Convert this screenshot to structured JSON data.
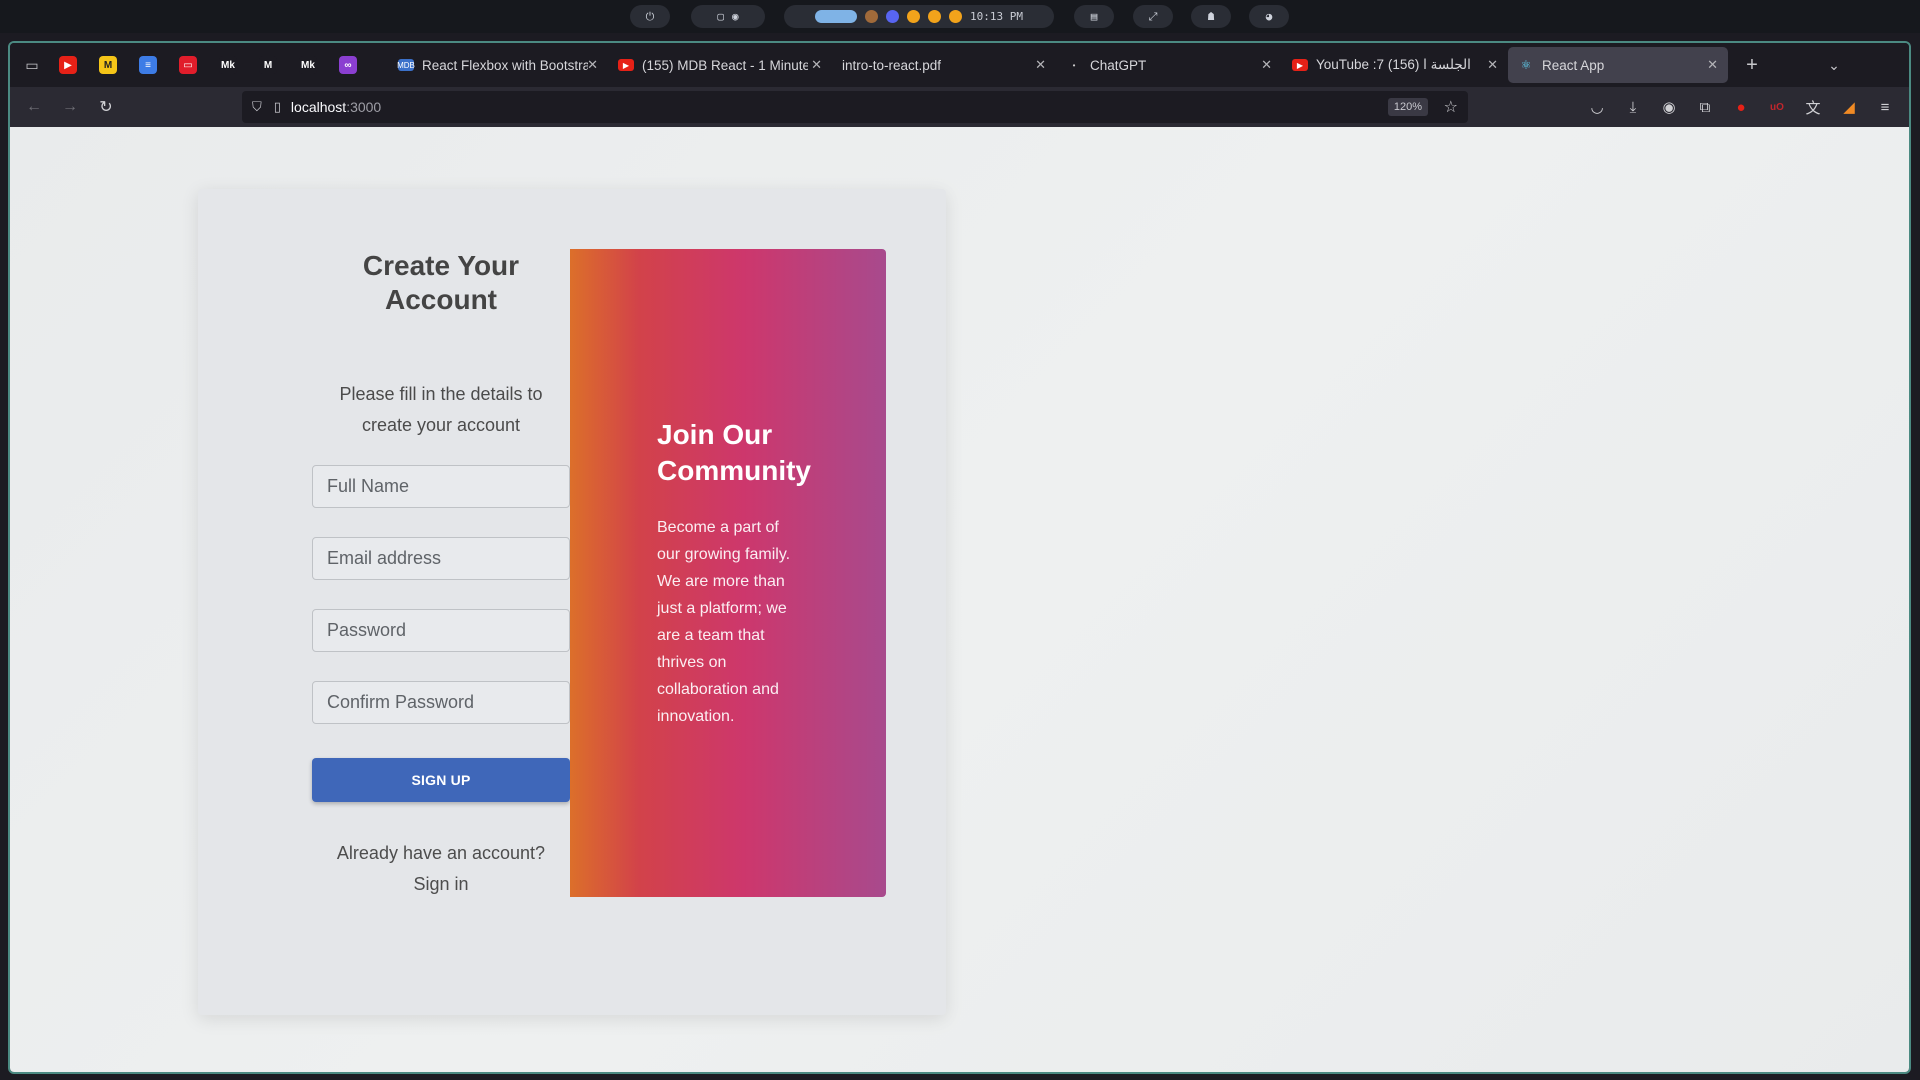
{
  "system_bar": {
    "clock": "10:13 PM"
  },
  "colors": {
    "accent_button": "#3f67b9",
    "window_border": "#4b8a82",
    "gradient_start": "#dc6f2a",
    "gradient_mid": "#cd376c",
    "gradient_end": "#a84a8d"
  },
  "tabs": [
    {
      "title": "React Flexbox with Bootstra",
      "favicon": "mdb-icon",
      "active": false
    },
    {
      "title": "(155) MDB React - 1 Minute",
      "favicon": "youtube-icon",
      "active": false
    },
    {
      "title": "intro-to-react.pdf",
      "favicon": "pdf-icon",
      "active": false
    },
    {
      "title": "ChatGPT",
      "favicon": "chatgpt-icon",
      "active": false
    },
    {
      "title": "YouTube :7 الجلسة ا (156)",
      "favicon": "youtube-icon",
      "active": false
    },
    {
      "title": "React App",
      "favicon": "react-icon",
      "active": true
    }
  ],
  "pinned_tabs": [
    "youtube-icon",
    "miro-icon",
    "docs-icon",
    "red-app-icon",
    "medium-icon",
    "gmail-icon",
    "medium-icon",
    "purple-app-icon"
  ],
  "navbar": {
    "url_host": "localhost",
    "url_port": ":3000",
    "zoom": "120%"
  },
  "page": {
    "title": "Create Your Account",
    "subtitle": "Please fill in the details to create your account",
    "fields": {
      "full_name": "Full Name",
      "email": "Email address",
      "password": "Password",
      "confirm_password": "Confirm Password"
    },
    "signup_label": "SIGN UP",
    "already_text": "Already have an account?",
    "signin_link": "Sign in",
    "promo_title": "Join Our Community",
    "promo_text": "Become a part of our growing family. We are more than just a platform; we are a team that thrives on collaboration and innovation."
  }
}
